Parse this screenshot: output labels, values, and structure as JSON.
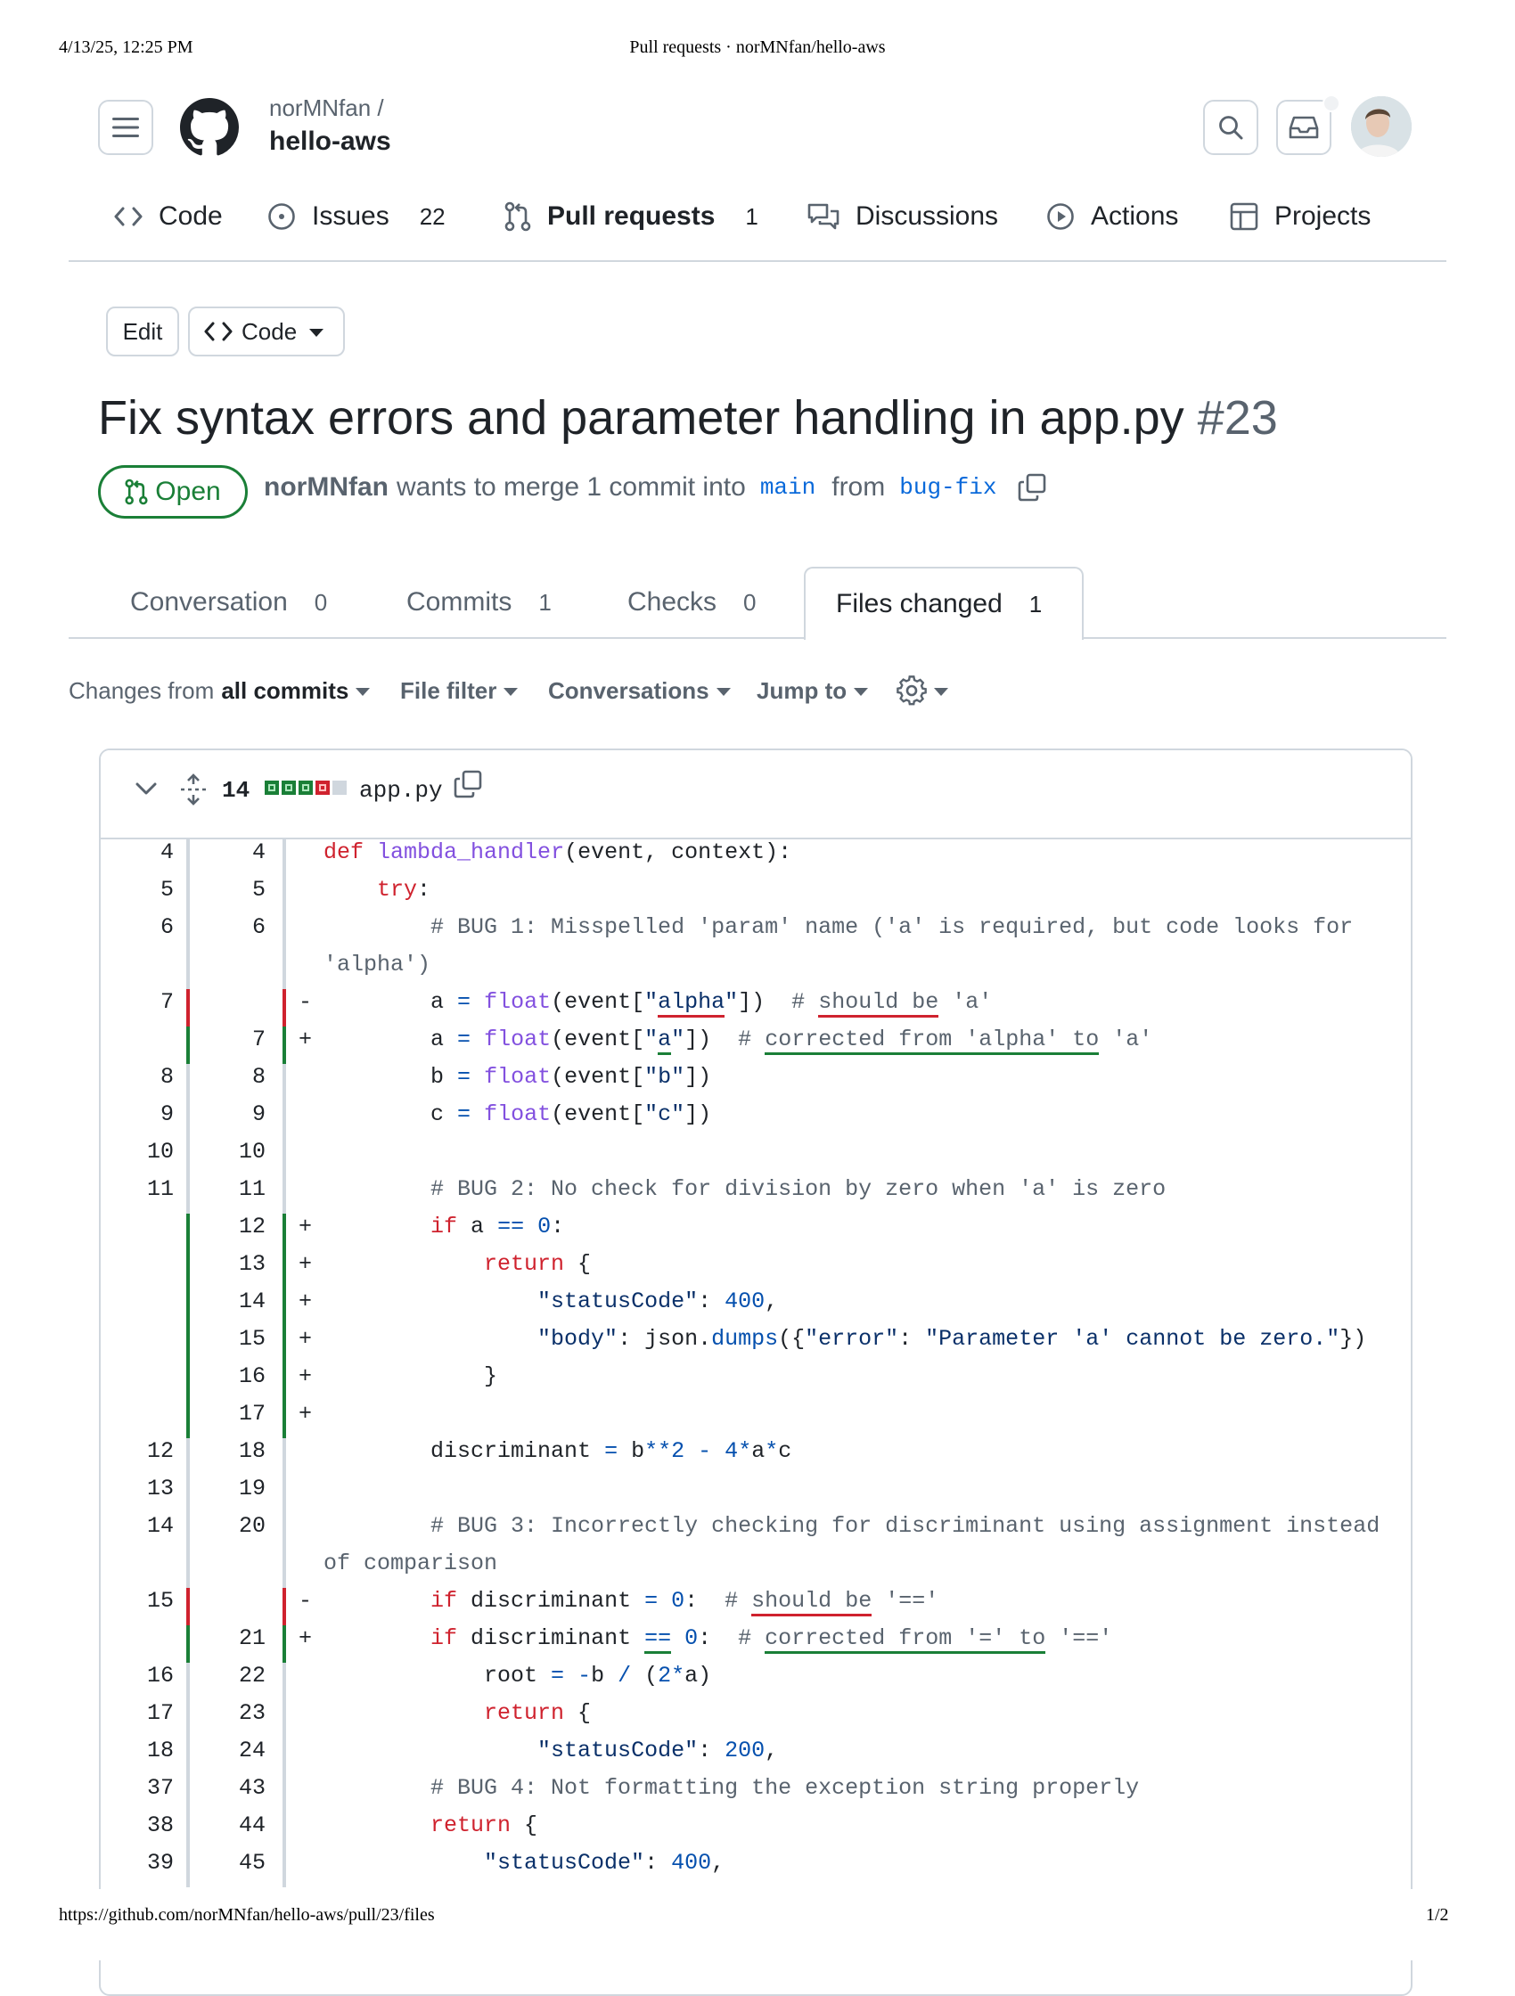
{
  "print_header": {
    "datetime": "4/13/25, 12:25 PM",
    "page_title": "Pull requests · norMNfan/hello-aws"
  },
  "print_footer": {
    "url": "https://github.com/norMNfan/hello-aws/pull/23/files",
    "page": "1/2"
  },
  "repo": {
    "owner": "norMNfan /",
    "name": "hello-aws"
  },
  "nav": {
    "code": "Code",
    "issues": "Issues",
    "issues_count": "22",
    "pull_requests": "Pull requests",
    "pull_requests_count": "1",
    "discussions": "Discussions",
    "actions": "Actions",
    "projects": "Projects"
  },
  "pr_actions": {
    "edit": "Edit",
    "code": "Code"
  },
  "pr": {
    "title": "Fix syntax errors and parameter handling in app.py",
    "number": "#23",
    "state": "Open",
    "author": "norMNfan",
    "merge_text": "wants to merge 1 commit into",
    "base": "main",
    "from": "from",
    "head": "bug-fix"
  },
  "tabs": [
    {
      "label": "Conversation",
      "count": "0"
    },
    {
      "label": "Commits",
      "count": "1"
    },
    {
      "label": "Checks",
      "count": "0"
    },
    {
      "label": "Files changed",
      "count": "1"
    }
  ],
  "toolbar": {
    "changes_from": "Changes from",
    "all_commits": "all commits",
    "file_filter": "File filter",
    "conversations": "Conversations",
    "jump_to": "Jump to"
  },
  "file": {
    "changes": "14",
    "name": "app.py"
  },
  "colors": {
    "added": "#1a7f37",
    "removed": "#cf222e",
    "accent": "#0969da",
    "border": "#d0d7de"
  },
  "diff_lines": [
    {
      "old": "4",
      "new": "4",
      "sign": "",
      "text": "def lambda_handler(event, context):"
    },
    {
      "old": "5",
      "new": "5",
      "sign": "",
      "text": "    try:"
    },
    {
      "old": "6",
      "new": "6",
      "sign": "",
      "text": "        # BUG 1: Misspelled 'param' name ('a' is required, but code looks for"
    },
    {
      "old": "",
      "new": "",
      "sign": "",
      "text": "'alpha')"
    },
    {
      "old": "7",
      "new": "",
      "sign": "-",
      "text": "        a = float(event[\"alpha\"])  # should be 'a'"
    },
    {
      "old": "",
      "new": "7",
      "sign": "+",
      "text": "        a = float(event[\"a\"])  # corrected from 'alpha' to 'a'"
    },
    {
      "old": "8",
      "new": "8",
      "sign": "",
      "text": "        b = float(event[\"b\"])"
    },
    {
      "old": "9",
      "new": "9",
      "sign": "",
      "text": "        c = float(event[\"c\"])"
    },
    {
      "old": "10",
      "new": "10",
      "sign": "",
      "text": ""
    },
    {
      "old": "11",
      "new": "11",
      "sign": "",
      "text": "        # BUG 2: No check for division by zero when 'a' is zero"
    },
    {
      "old": "",
      "new": "12",
      "sign": "+",
      "text": "        if a == 0:"
    },
    {
      "old": "",
      "new": "13",
      "sign": "+",
      "text": "            return {"
    },
    {
      "old": "",
      "new": "14",
      "sign": "+",
      "text": "                \"statusCode\": 400,"
    },
    {
      "old": "",
      "new": "15",
      "sign": "+",
      "text": "                \"body\": json.dumps({\"error\": \"Parameter 'a' cannot be zero.\"})"
    },
    {
      "old": "",
      "new": "16",
      "sign": "+",
      "text": "            }"
    },
    {
      "old": "",
      "new": "17",
      "sign": "+",
      "text": ""
    },
    {
      "old": "12",
      "new": "18",
      "sign": "",
      "text": "        discriminant = b**2 - 4*a*c"
    },
    {
      "old": "13",
      "new": "19",
      "sign": "",
      "text": ""
    },
    {
      "old": "14",
      "new": "20",
      "sign": "",
      "text": "        # BUG 3: Incorrectly checking for discriminant using assignment instead"
    },
    {
      "old": "",
      "new": "",
      "sign": "",
      "text": "of comparison"
    },
    {
      "old": "15",
      "new": "",
      "sign": "-",
      "text": "        if discriminant = 0:  # should be '=='"
    },
    {
      "old": "",
      "new": "21",
      "sign": "+",
      "text": "        if discriminant == 0:  # corrected from '=' to '=='"
    },
    {
      "old": "16",
      "new": "22",
      "sign": "",
      "text": "            root = -b / (2*a)"
    },
    {
      "old": "17",
      "new": "23",
      "sign": "",
      "text": "            return {"
    },
    {
      "old": "18",
      "new": "24",
      "sign": "",
      "text": "                \"statusCode\": 200,"
    },
    {
      "old": "37",
      "new": "43",
      "sign": "",
      "text": "        # BUG 4: Not formatting the exception string properly"
    },
    {
      "old": "38",
      "new": "44",
      "sign": "",
      "text": "        return {"
    },
    {
      "old": "39",
      "new": "45",
      "sign": "",
      "text": "            \"statusCode\": 400,"
    }
  ]
}
